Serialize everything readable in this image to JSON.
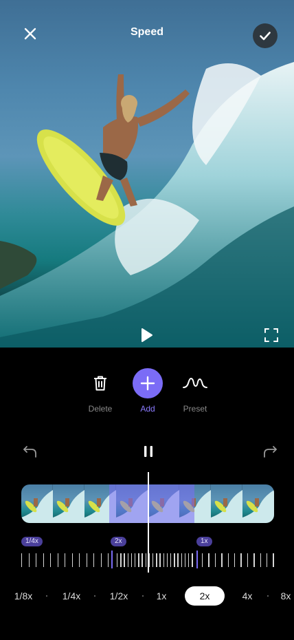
{
  "header": {
    "title": "Speed"
  },
  "icons": {
    "close": "close-icon",
    "confirm": "checkmark-icon",
    "play": "play-icon",
    "fullscreen": "fullscreen-icon",
    "delete": "trash-icon",
    "add": "plus-icon",
    "preset": "curve-icon",
    "undo": "undo-icon",
    "pause": "pause-icon",
    "redo": "redo-icon"
  },
  "tools": {
    "delete_label": "Delete",
    "add_label": "Add",
    "preset_label": "Preset"
  },
  "markers": [
    "1/4x",
    "2x",
    "1x"
  ],
  "speeds": {
    "options": [
      "1/8x",
      "1/4x",
      "1/2x",
      "1x",
      "2x",
      "4x",
      "8x"
    ],
    "selected": "2x"
  },
  "colors": {
    "accent": "#7b6cf6",
    "background": "#000000"
  }
}
